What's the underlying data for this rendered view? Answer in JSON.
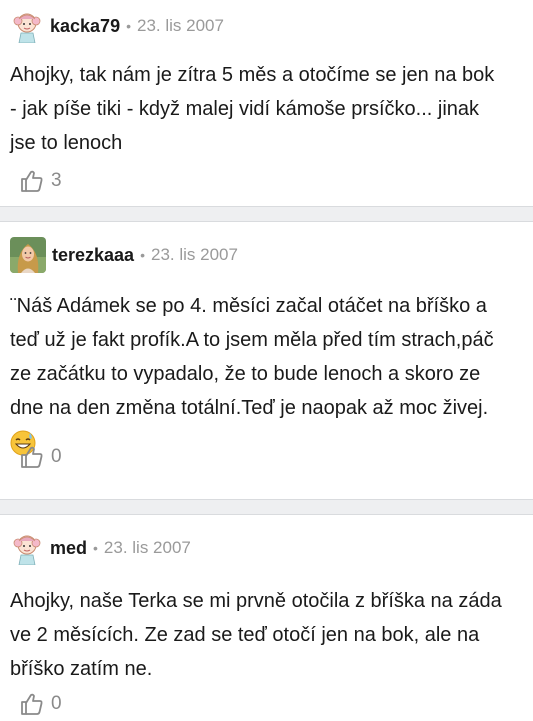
{
  "posts": [
    {
      "author": "kacka79",
      "separator": "•",
      "date": "23. lis 2007",
      "text_lines": [
        "Ahojky, tak nám je zítra 5 měs a otočíme se jen na bok",
        "- jak píše tiki - když malej vidí kámoše prsíčko... jinak",
        "jse to lenoch"
      ],
      "likes": "3",
      "avatar_icon": "cartoon-girl-avatar"
    },
    {
      "author": "terezkaaa",
      "separator": "•",
      "date": "23. lis 2007",
      "text_lines": [
        "¨Náš Adámek se po 4. měsíci začal otáčet na bříško a",
        "teď už je fakt profík.A to jsem měla před tím strach,páč",
        "ze začátku to vypadalo, že to bude lenoch a skoro ze",
        "dne na den změna totální.Teď je naopak až moc živej."
      ],
      "emoji": "sweat-smile-emoji",
      "likes": "0",
      "avatar_icon": "photo-avatar-woman"
    },
    {
      "author": "med",
      "separator": "•",
      "date": "23. lis 2007",
      "text_lines": [
        "Ahojky, naše Terka se mi prvně otočila z bříška na záda",
        "ve 2 měsících. Ze zad se teď otočí jen na bok, ale na",
        "bříško zatím ne."
      ],
      "likes": "0",
      "avatar_icon": "cartoon-girl-avatar"
    }
  ],
  "colors": {
    "text": "#1a1a1a",
    "muted": "#9a9a9a",
    "divider_bg": "#eeeff1"
  }
}
